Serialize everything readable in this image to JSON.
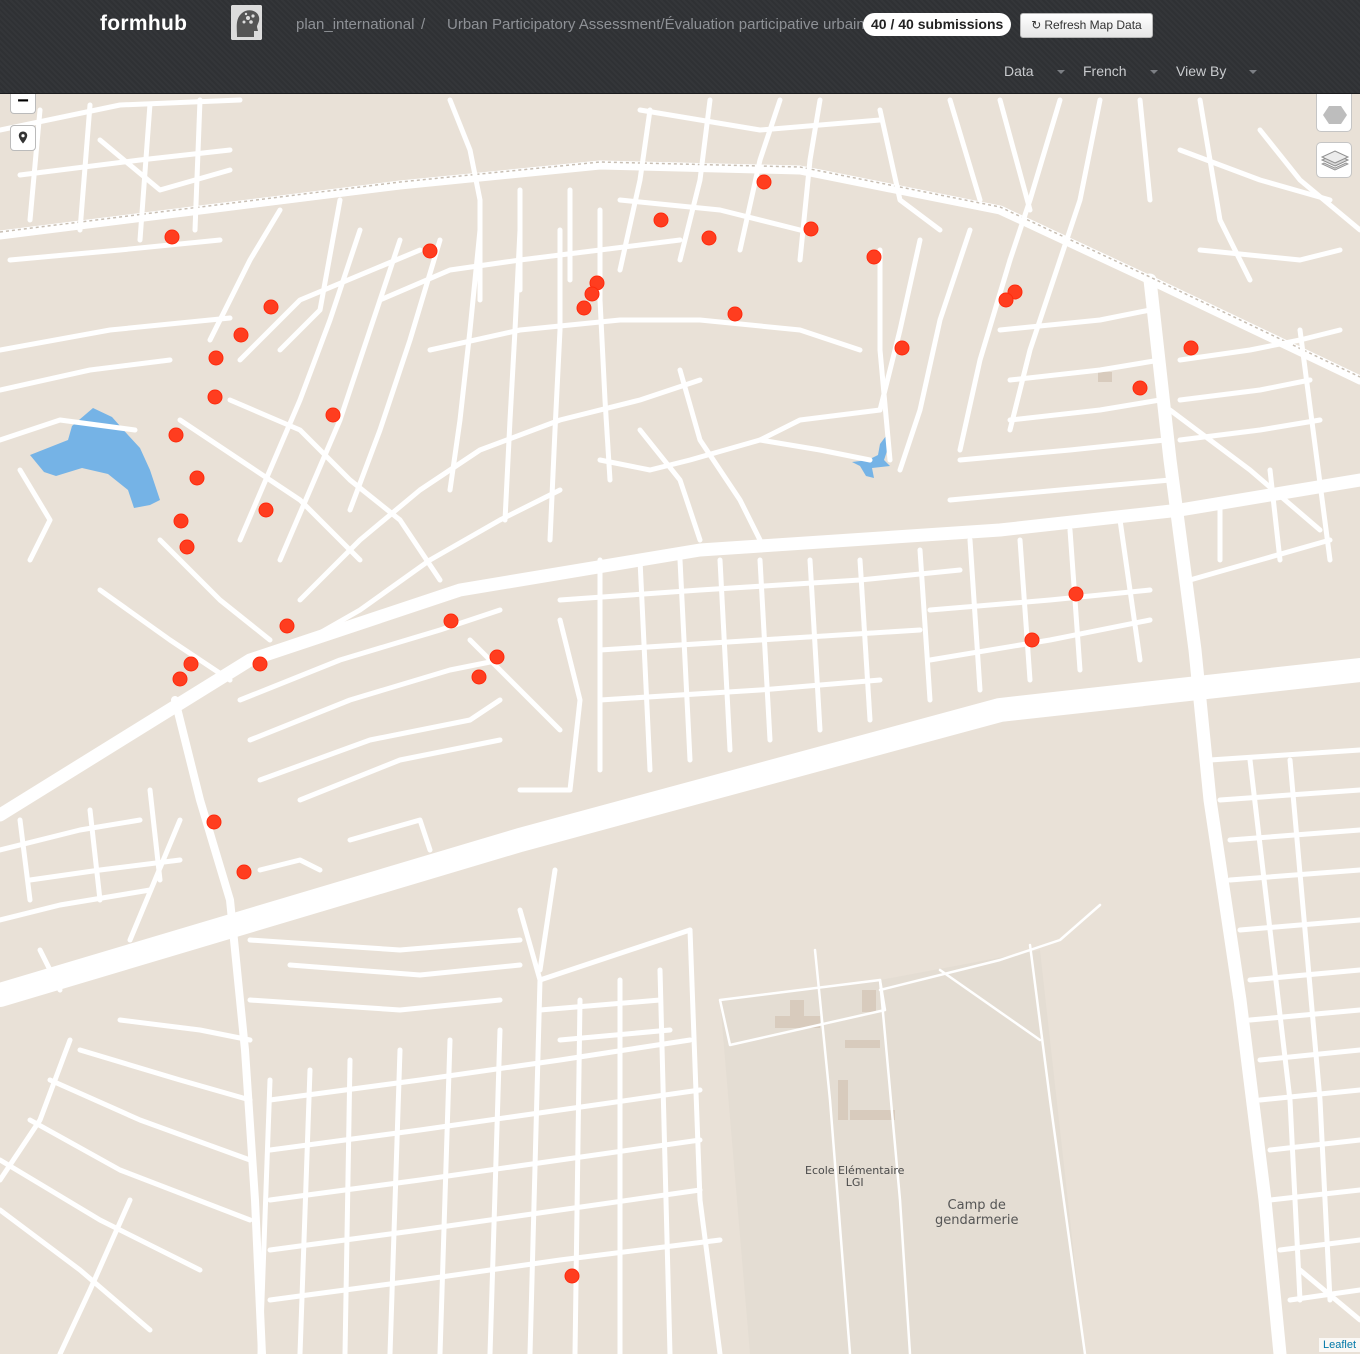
{
  "header": {
    "brand": "formhub",
    "org_name": "plan_international",
    "separator": "/",
    "form_title": "Urban Participatory Assessment/Évaluation participative urbaine",
    "submissions_badge": "40 / 40 submissions",
    "refresh_label": "Refresh Map Data",
    "menus": {
      "data": "Data",
      "language": "French",
      "view_by": "View By"
    }
  },
  "map": {
    "zoom_out_label": "−",
    "labels": {
      "school_line1": "Ecole Elémentaire",
      "school_line2": "LGI",
      "camp_line1": "Camp de",
      "camp_line2": "gendarmerie"
    },
    "attribution": "Leaflet",
    "marker_color": "#ff3d1f",
    "water_color": "#75b3e6",
    "land_color": "#e9e1d7",
    "road_color": "#ffffff"
  }
}
